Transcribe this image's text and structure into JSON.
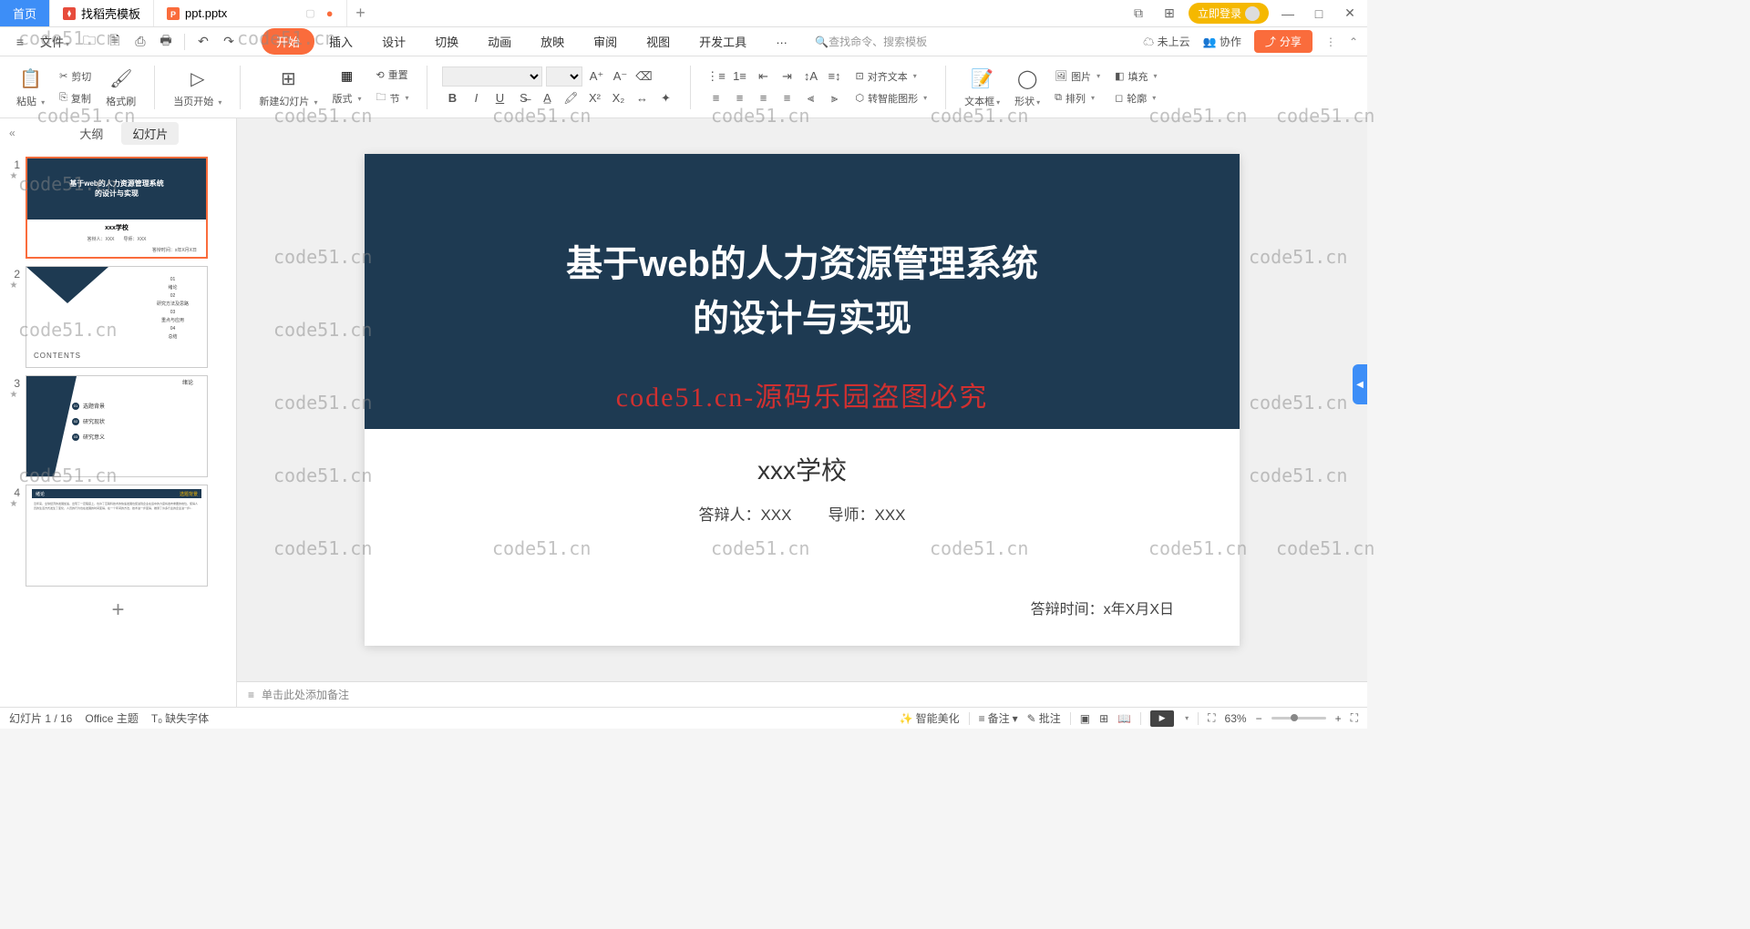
{
  "titlebar": {
    "tabs": [
      {
        "label": "首页",
        "type": "home"
      },
      {
        "label": "找稻壳模板",
        "icon": "red"
      },
      {
        "label": "ppt.pptx",
        "icon": "orange",
        "active": true
      }
    ],
    "login": "立即登录"
  },
  "menubar": {
    "file": "文件",
    "tabs": [
      "开始",
      "插入",
      "设计",
      "切换",
      "动画",
      "放映",
      "审阅",
      "视图",
      "开发工具",
      "…"
    ],
    "active_tab": 0,
    "search_placeholder": "查找命令、搜索模板",
    "cloud": "未上云",
    "collab": "协作",
    "share": "分享"
  },
  "ribbon": {
    "paste": "粘贴",
    "cut": "剪切",
    "copy": "复制",
    "format_painter": "格式刷",
    "from_current": "当页开始",
    "new_slide": "新建幻灯片",
    "layout": "版式",
    "section": "节",
    "reset": "重置",
    "align_text": "对齐文本",
    "to_smartart": "转智能图形",
    "textbox": "文本框",
    "shape": "形状",
    "picture": "图片",
    "arrange": "排列",
    "fill": "填充",
    "outline": "轮廓"
  },
  "sidepanel": {
    "outline_tab": "大纲",
    "slides_tab": "幻灯片",
    "thumbs": {
      "t1_line1": "基于web的人力资源管理系统",
      "t1_line2": "的设计与实现",
      "t1_school": "xxx学校",
      "t1_info": "答辩人：XXX　　导师：XXX",
      "t2_items": [
        "01",
        "绪论",
        "02",
        "研究方法及思路",
        "03",
        "重点与应用",
        "04",
        "总结"
      ],
      "t2_contents": "CONTENTS",
      "t3_header": "绪论",
      "t3_items": [
        "选题背景",
        "研究现状",
        "研究意义"
      ],
      "t4_left": "绪论",
      "t4_right": "选题背景"
    }
  },
  "slide": {
    "title_line1": "基于web的人力资源管理系统",
    "title_line2": "的设计与实现",
    "school": "xxx学校",
    "presenter_label": "答辩人：",
    "presenter": "XXX",
    "advisor_label": "导师：",
    "advisor": "XXX",
    "time_label": "答辩时间：",
    "time": "x年X月X日"
  },
  "notes": {
    "placeholder": "单击此处添加备注"
  },
  "statusbar": {
    "slide_counter": "幻灯片 1 / 16",
    "theme": "Office 主题",
    "missing_font": "缺失字体",
    "smart_beautify": "智能美化",
    "notes_btn": "备注",
    "comments_btn": "批注",
    "zoom": "63%"
  },
  "watermark": "code51.cn",
  "center_watermark": "code51.cn-源码乐园盗图必究"
}
